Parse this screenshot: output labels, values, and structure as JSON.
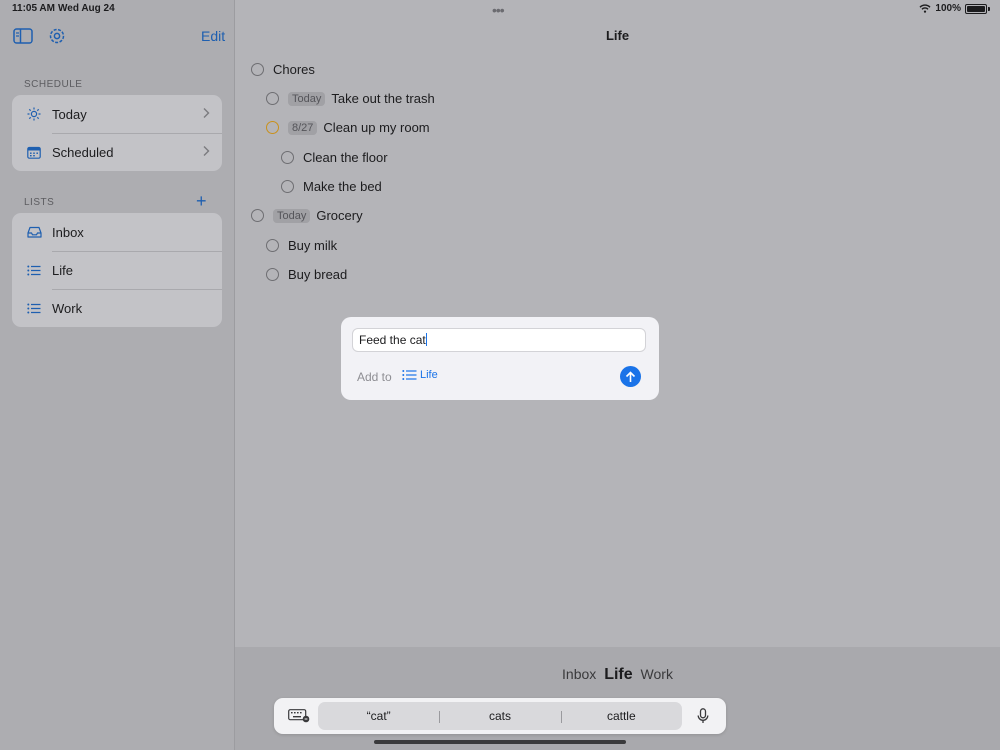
{
  "status_bar": {
    "time": "11:05 AM",
    "date": "Wed Aug 24",
    "battery": "100%"
  },
  "sidebar": {
    "edit_label": "Edit",
    "schedule_label": "SCHEDULE",
    "schedule_items": [
      {
        "label": "Today",
        "icon": "sun-icon"
      },
      {
        "label": "Scheduled",
        "icon": "calendar-icon"
      }
    ],
    "lists_label": "LISTS",
    "add_list_label": "+",
    "list_items": [
      {
        "label": "Inbox",
        "icon": "tray-icon"
      },
      {
        "label": "Life",
        "icon": "list-icon"
      },
      {
        "label": "Work",
        "icon": "list-icon"
      }
    ]
  },
  "main": {
    "title": "Life",
    "tasks": [
      {
        "label": "Chores",
        "chip": ""
      },
      {
        "label": "Take out the trash",
        "chip": "Today"
      },
      {
        "label": "Clean up my room",
        "chip": "8/27"
      },
      {
        "label": "Clean the floor",
        "chip": ""
      },
      {
        "label": "Make the bed",
        "chip": ""
      },
      {
        "label": "Grocery",
        "chip": "Today"
      },
      {
        "label": "Buy milk",
        "chip": ""
      },
      {
        "label": "Buy bread",
        "chip": ""
      }
    ]
  },
  "quick_add": {
    "input_value": "Feed the cat",
    "add_to_label": "Add to",
    "target_list": "Life"
  },
  "list_switcher": {
    "items": [
      "Inbox",
      "Life",
      "Work"
    ],
    "active": "Life"
  },
  "keyboard_suggestions": [
    "“cat”",
    "cats",
    "cattle"
  ],
  "colors": {
    "accent": "#1a73e8",
    "flag": "#c9911c"
  }
}
